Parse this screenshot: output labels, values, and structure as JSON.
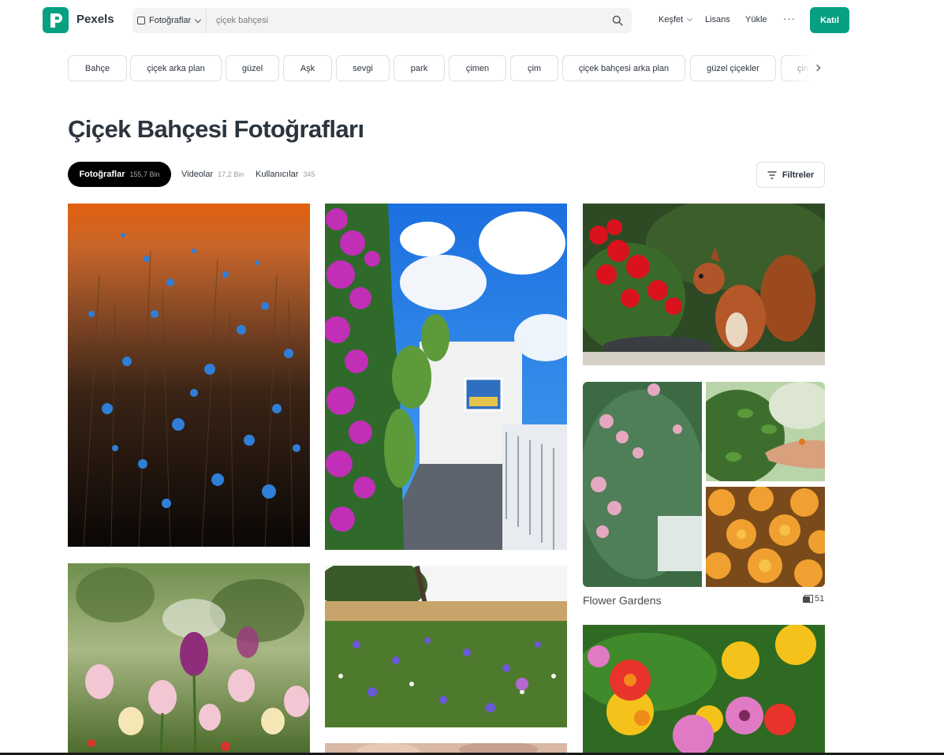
{
  "header": {
    "brand": "Pexels",
    "search": {
      "type_label": "Fotoğraflar",
      "query": "çiçek bahçesi"
    },
    "nav": {
      "explore": "Keşfet",
      "license": "Lisans",
      "upload": "Yükle",
      "more": "···",
      "join": "Katıl"
    }
  },
  "chips": [
    "Bahçe",
    "çiçek arka plan",
    "güzel",
    "Aşk",
    "sevgi",
    "park",
    "çimen",
    "çim",
    "çiçek bahçesi arka plan",
    "güzel çiçekler",
    "çim a"
  ],
  "page_title": "Çiçek Bahçesi Fotoğrafları",
  "tabs": {
    "photos": {
      "label": "Fotoğraflar",
      "count": "155,7 Bin"
    },
    "videos": {
      "label": "Videolar",
      "count": "17,2 Bin"
    },
    "users": {
      "label": "Kullanıcılar",
      "count": "345"
    }
  },
  "filters_label": "Filtreler",
  "collection": {
    "title": "Flower Gardens",
    "count": "51"
  },
  "colors": {
    "brand": "#07a081",
    "text": "#2c343e"
  }
}
